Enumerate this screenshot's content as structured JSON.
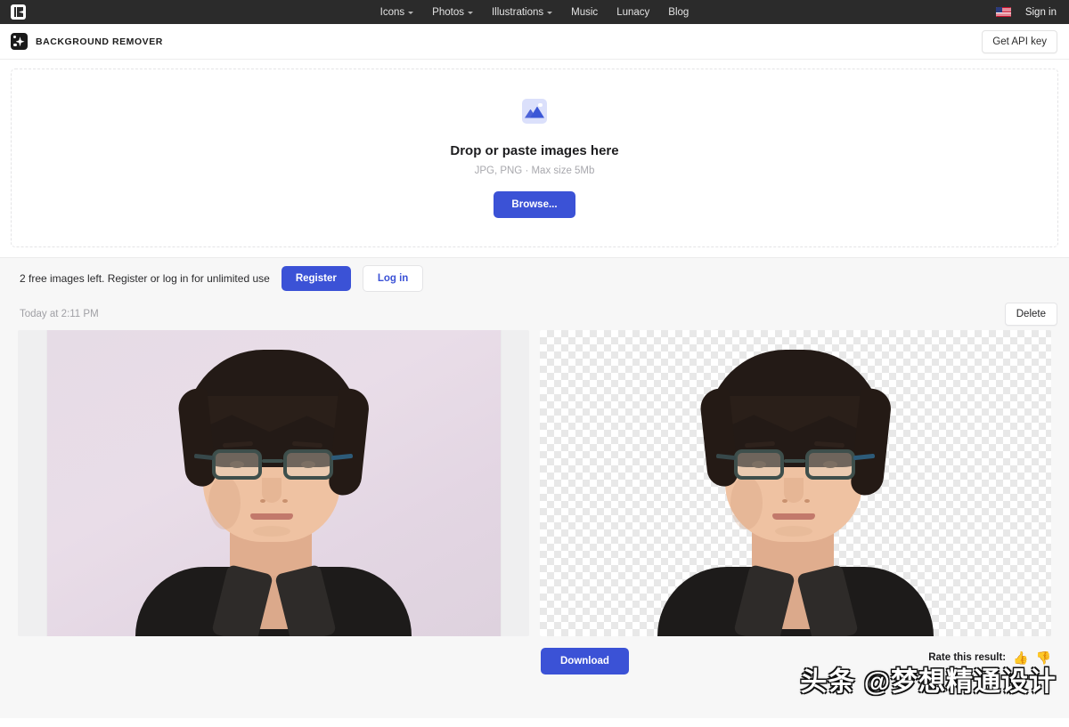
{
  "topnav": {
    "logo_icon": "icons8-logo-icon",
    "items": [
      {
        "label": "Icons",
        "has_caret": true
      },
      {
        "label": "Photos",
        "has_caret": true
      },
      {
        "label": "Illustrations",
        "has_caret": true
      },
      {
        "label": "Music",
        "has_caret": false
      },
      {
        "label": "Lunacy",
        "has_caret": false
      },
      {
        "label": "Blog",
        "has_caret": false
      }
    ],
    "flag_icon": "us-flag-icon",
    "signin_label": "Sign in"
  },
  "productbar": {
    "brand_icon": "sparkle-logo-icon",
    "brand_title": "BACKGROUND REMOVER",
    "api_button_label": "Get API key"
  },
  "dropzone": {
    "icon": "image-placeholder-icon",
    "title": "Drop or paste images here",
    "subtitle": "JPG, PNG · Max size 5Mb",
    "browse_label": "Browse..."
  },
  "limitbar": {
    "message": "2 free images left. Register or log in for unlimited use",
    "register_label": "Register",
    "login_label": "Log in"
  },
  "result": {
    "timestamp": "Today at 2:11 PM",
    "delete_label": "Delete",
    "download_label": "Download",
    "rate_label": "Rate this result:",
    "thumbs_up": "👍",
    "thumbs_down": "👎",
    "original_alt": "original-portrait-photo",
    "cutout_alt": "background-removed-portrait"
  },
  "watermark": {
    "text": "头条 @梦想精通设计"
  },
  "colors": {
    "accent_blue": "#3b52d6",
    "nav_dark": "#2b2b2b",
    "page_bg": "#f7f7f7"
  }
}
